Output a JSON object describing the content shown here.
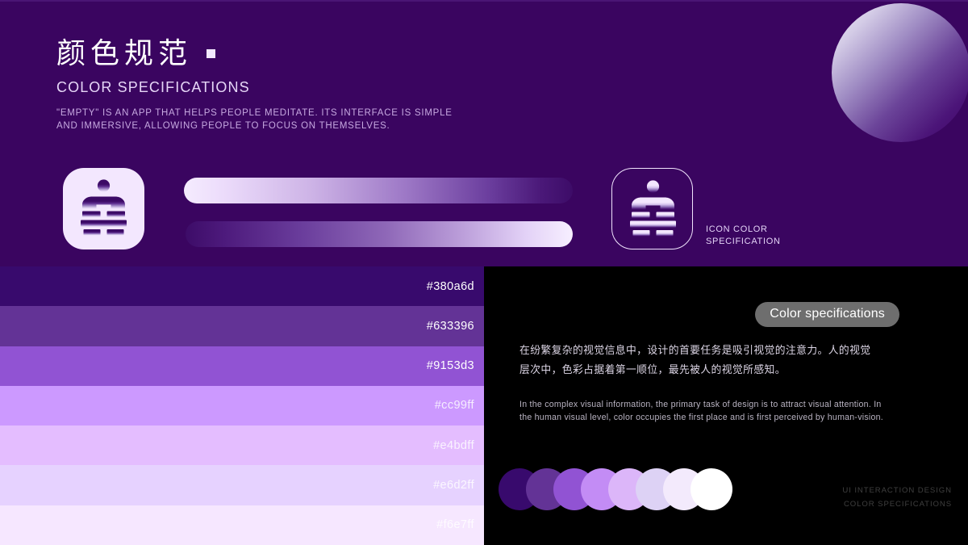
{
  "page": {
    "background_color": "#3a0560",
    "panel_background_color": "#000000"
  },
  "header": {
    "title_cn": "颜色规范",
    "title_en": "COLOR SPECIFICATIONS",
    "subtitle": "\"EMPTY\" IS AN APP THAT HELPS PEOPLE MEDITATE. ITS INTERFACE IS SIMPLE AND IMMERSIVE, ALLOWING PEOPLE TO FOCUS ON THEMSELVES."
  },
  "icons": {
    "app_icon_light_name": "meditation-figure-icon",
    "app_icon_dark_name": "meditation-figure-outline-icon",
    "icon_label": "ICON COLOR\nSPECIFICATION"
  },
  "gradient_bars": [
    {
      "name": "light-to-dark-bar",
      "from": "#f5ecfe",
      "to": "#3d0c68"
    },
    {
      "name": "dark-to-light-bar",
      "from": "#3d0c68",
      "to": "#f7efff"
    }
  ],
  "swatches": [
    {
      "hex": "#380a6d",
      "label": "#380a6d",
      "text": "light"
    },
    {
      "hex": "#633396",
      "label": "#633396",
      "text": "light"
    },
    {
      "hex": "#9153d3",
      "label": "#9153d3",
      "text": "light"
    },
    {
      "hex": "#cc99ff",
      "label": "#cc99ff",
      "text": "dim"
    },
    {
      "hex": "#e4bdff",
      "label": "#e4bdff",
      "text": "dim"
    },
    {
      "hex": "#e6d2ff",
      "label": "#e6d2ff",
      "text": "dim"
    },
    {
      "hex": "#f6e7ff",
      "label": "#f6e7ff",
      "text": "dim"
    }
  ],
  "panel": {
    "pill_label": "Color specifications",
    "body_cn": "在纷繁复杂的视觉信息中，设计的首要任务是吸引视觉的注意力。人的视觉层次中，色彩占据着第一顺位，最先被人的视觉所感知。",
    "body_en": "In the complex visual information, the primary task of design is to attract visual attention. In the human visual level, color  occupies the first place and is first perceived by human-vision.",
    "circle_palette": [
      "#380a6d",
      "#633396",
      "#9153d3",
      "#c38cf5",
      "#dcb6f9",
      "#ddd2f5",
      "#f3eafc",
      "#ffffff"
    ],
    "footer_line1": "UI INTERACTION DESIGN",
    "footer_line2": "COLOR SPECIFICATIONS"
  }
}
